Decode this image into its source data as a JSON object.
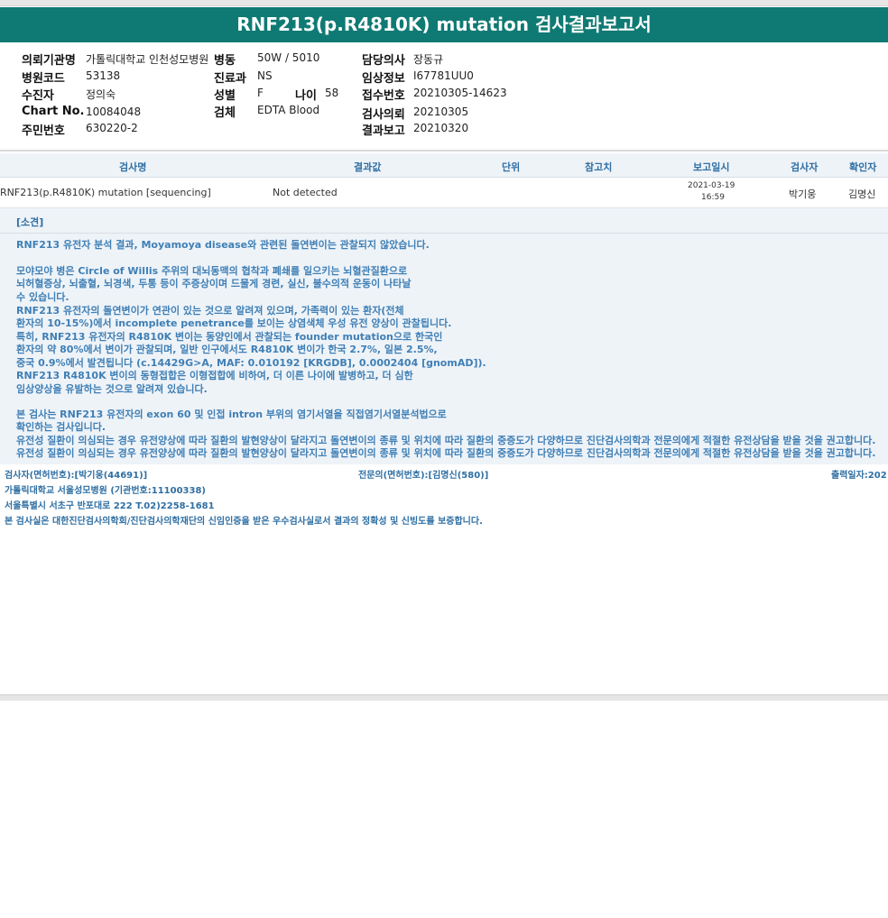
{
  "report": {
    "title": "RNF213(p.R4810K) mutation 검사결과보고서"
  },
  "info": {
    "institution_label": "의뢰기관명",
    "institution": "가톨릭대학교 인천성모병원",
    "ward_label": "병동",
    "ward": "50W / 5010",
    "doctor_label": "담당의사",
    "doctor": "장동규",
    "hospital_code_label": "병원코드",
    "hospital_code": "53138",
    "dept_label": "진료과",
    "dept": "NS",
    "clinical_label": "임상정보",
    "clinical": "I67781UU0",
    "recipient_label": "수진자",
    "recipient": "정의숙",
    "sex_label": "성별",
    "sex": "F",
    "age_label": "나이",
    "age": "58",
    "receipt_label": "접수번호",
    "receipt": "20210305-14623",
    "chart_label": "Chart No.",
    "chart": "10084048",
    "specimen_label": "검체",
    "specimen": "EDTA Blood",
    "request_label": "검사의뢰",
    "request": "20210305",
    "rrn_label": "주민번호",
    "rrn": "630220-2",
    "result_report_label": "결과보고",
    "result_report": "20210320"
  },
  "table": {
    "headers": [
      "검사명",
      "결과값",
      "단위",
      "참고치",
      "보고일시",
      "검사자",
      "확인자"
    ],
    "rows": [
      {
        "test_name": "RNF213(p.R4810K) mutation [sequencing]",
        "result": "Not detected",
        "unit": "",
        "reference": "",
        "report_date": "2021-03-19",
        "report_time": "16:59",
        "tester": "박기웅",
        "confirmer": "김명신"
      }
    ]
  },
  "findings": {
    "heading": "[소견]",
    "lines": [
      "RNF213 유전자 분석 결과, Moyamoya disease와 관련된 돌연변이는 관찰되지 않았습니다.",
      "",
      "모야모야 병은 Circle of Willis 주위의 대뇌동맥의 협착과 폐쇄를 일으키는 뇌혈관질환으로",
      "뇌허혈증상, 뇌출혈, 뇌경색, 두통 등이 주증상이며 드물게 경련, 실신, 불수의적 운동이 나타날",
      "수 있습니다.",
      "RNF213 유전자의 돌연변이가 연관이 있는 것으로 알려져 있으며, 가족력이 있는 환자(전체",
      "환자의 10-15%)에서 incomplete penetrance를 보이는 상염색체 우성 유전 양상이 관찰됩니다.",
      "특히, RNF213 유전자의 R4810K 변이는 동양인에서 관찰되는 founder mutation으로 한국인",
      "환자의 약 80%에서 변이가 관찰되며, 일반 인구에서도 R4810K 변이가 한국 2.7%, 일본 2.5%,",
      "중국 0.9%에서 발견됩니다 (c.14429G>A, MAF: 0.010192 [KRGDB], 0.0002404 [gnomAD]).",
      "RNF213 R4810K 변이의 동형접합은 이형접합에 비하여, 더 이른 나이에 발병하고, 더 심한",
      "임상양상을 유발하는 것으로 알려져 있습니다.",
      "",
      "본 검사는 RNF213 유전자의 exon 60 및 인접 intron 부위의 염기서열을 직접염기서열분석법으로",
      "확인하는 검사입니다.",
      "유전성 질환이 의심되는 경우 유전양상에 따라 질환의 발현양상이 달라지고 돌연변이의 종류 및 위치에 따라 질환의 중증도가 다양하므로 진단검사의학과 전문의에게 적절한 유전상담을 받을 것을 권고합니다.",
      "유전성 질환이 의심되는 경우 유전양상에 따라 질환의 발현양상이 달라지고 돌연변이의 종류 및 위치에 따라 질환의 중증도가 다양하므로 진단검사의학과 전문의에게 적절한 유전상담을 받을 것을 권고합니다."
    ]
  },
  "footer": {
    "tester": "검사자(면허번호):[박기웅(44691)]",
    "specialist": "전문의(면허번호):[김명신(580)]",
    "print_date": "출력일자:202",
    "hospital": "가톨릭대학교 서울성모병원 (기관번호:11100338)",
    "address": "서울특별시 서초구 반포대로 222 T.02)2258-1681",
    "certification": "본 검사실은 대한진단검사의학회/진단검사의학재단의 신임인증을 받은 우수검사실로서 결과의 정확성 및 신빙도를 보증합니다."
  }
}
